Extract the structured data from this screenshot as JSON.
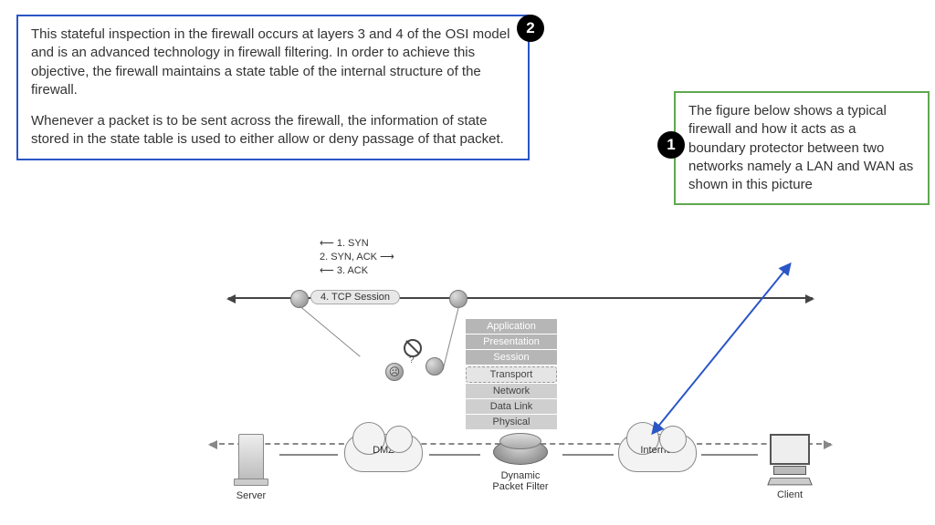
{
  "boxes": {
    "blue": {
      "p1": "This stateful inspection in the firewall occurs at layers 3 and 4 of the OSI model and is an advanced technology in firewall filtering. In order to achieve this objective, the firewall maintains a state table of the internal structure of the firewall.",
      "p2": "Whenever a packet is to be sent across the firewall, the information of state stored in the state table is used to either allow or deny passage of that packet."
    },
    "green": {
      "text": "The figure below shows a typical firewall and how it acts as a boundary protector between two networks namely a LAN and WAN as shown in this picture"
    }
  },
  "badges": {
    "one": "1",
    "two": "2"
  },
  "handshake": {
    "l1": "⟵ 1. SYN",
    "l2": "    2. SYN, ACK ⟶",
    "l3": "⟵ 3. ACK",
    "session": "4. TCP Session"
  },
  "osi": {
    "app": "Application",
    "pres": "Presentation",
    "sess": "Session",
    "trans": "Transport",
    "net": "Network",
    "data": "Data Link",
    "phys": "Physical"
  },
  "bottom": {
    "server": "Server",
    "dmz": "DMZ",
    "filter1": "Dynamic",
    "filter2": "Packet Filter",
    "internet": "Internet",
    "client": "Client"
  }
}
